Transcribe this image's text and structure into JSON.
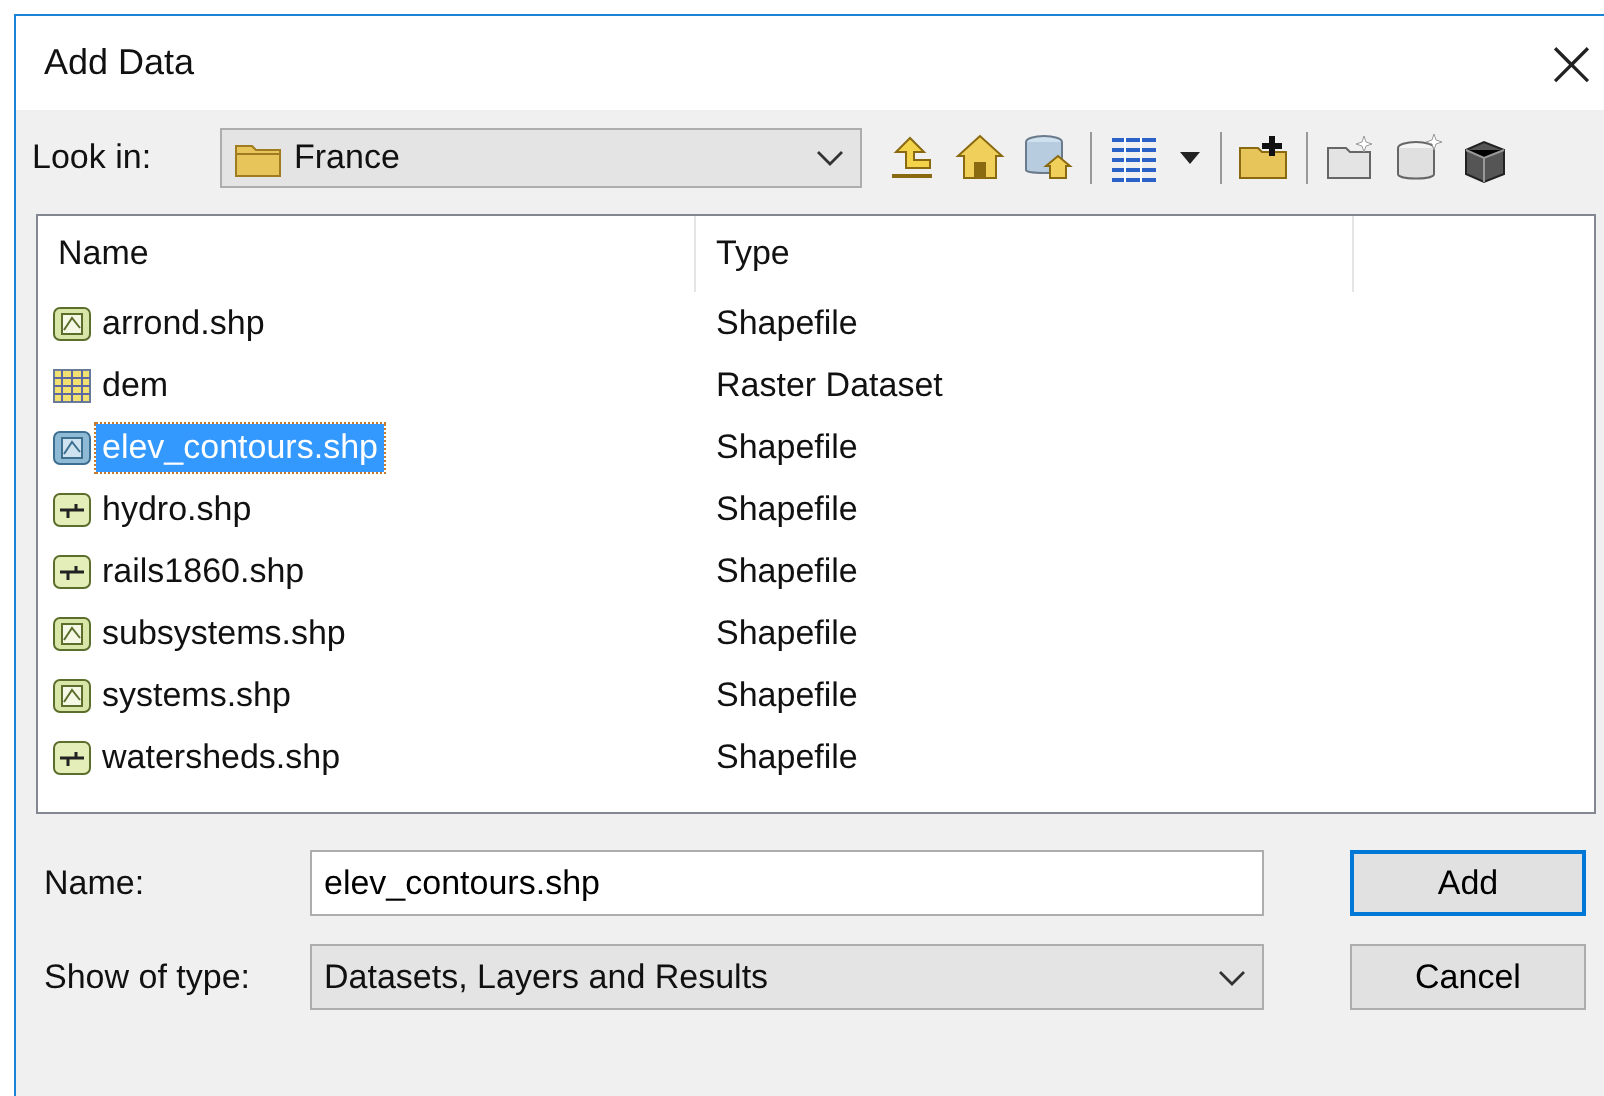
{
  "window": {
    "title": "Add Data",
    "close": "×"
  },
  "look_in": {
    "label": "Look in:",
    "value": "France"
  },
  "toolbar": [
    {
      "kind": "up"
    },
    {
      "kind": "home"
    },
    {
      "kind": "dbhome"
    },
    {
      "kind": "sep"
    },
    {
      "kind": "grid"
    },
    {
      "kind": "caret"
    },
    {
      "kind": "sep"
    },
    {
      "kind": "connect"
    },
    {
      "kind": "sep"
    },
    {
      "kind": "newfolder"
    },
    {
      "kind": "newdb"
    },
    {
      "kind": "toolbox"
    }
  ],
  "table": {
    "columns": [
      "Name",
      "Type"
    ],
    "rows": [
      {
        "name": "arrond.shp",
        "type": "Shapefile",
        "kind": "polygon",
        "selected": false
      },
      {
        "name": "dem",
        "type": "Raster Dataset",
        "kind": "raster",
        "selected": false
      },
      {
        "name": "elev_contours.shp",
        "type": "Shapefile",
        "kind": "polygon",
        "selected": true
      },
      {
        "name": "hydro.shp",
        "type": "Shapefile",
        "kind": "line",
        "selected": false
      },
      {
        "name": "rails1860.shp",
        "type": "Shapefile",
        "kind": "line",
        "selected": false
      },
      {
        "name": "subsystems.shp",
        "type": "Shapefile",
        "kind": "polygon",
        "selected": false
      },
      {
        "name": "systems.shp",
        "type": "Shapefile",
        "kind": "polygon",
        "selected": false
      },
      {
        "name": "watersheds.shp",
        "type": "Shapefile",
        "kind": "line",
        "selected": false
      }
    ]
  },
  "name_field": {
    "label": "Name:",
    "value": "elev_contours.shp"
  },
  "type_field": {
    "label": "Show of type:",
    "value": "Datasets, Layers and Results"
  },
  "buttons": [
    "Add",
    "Cancel"
  ]
}
